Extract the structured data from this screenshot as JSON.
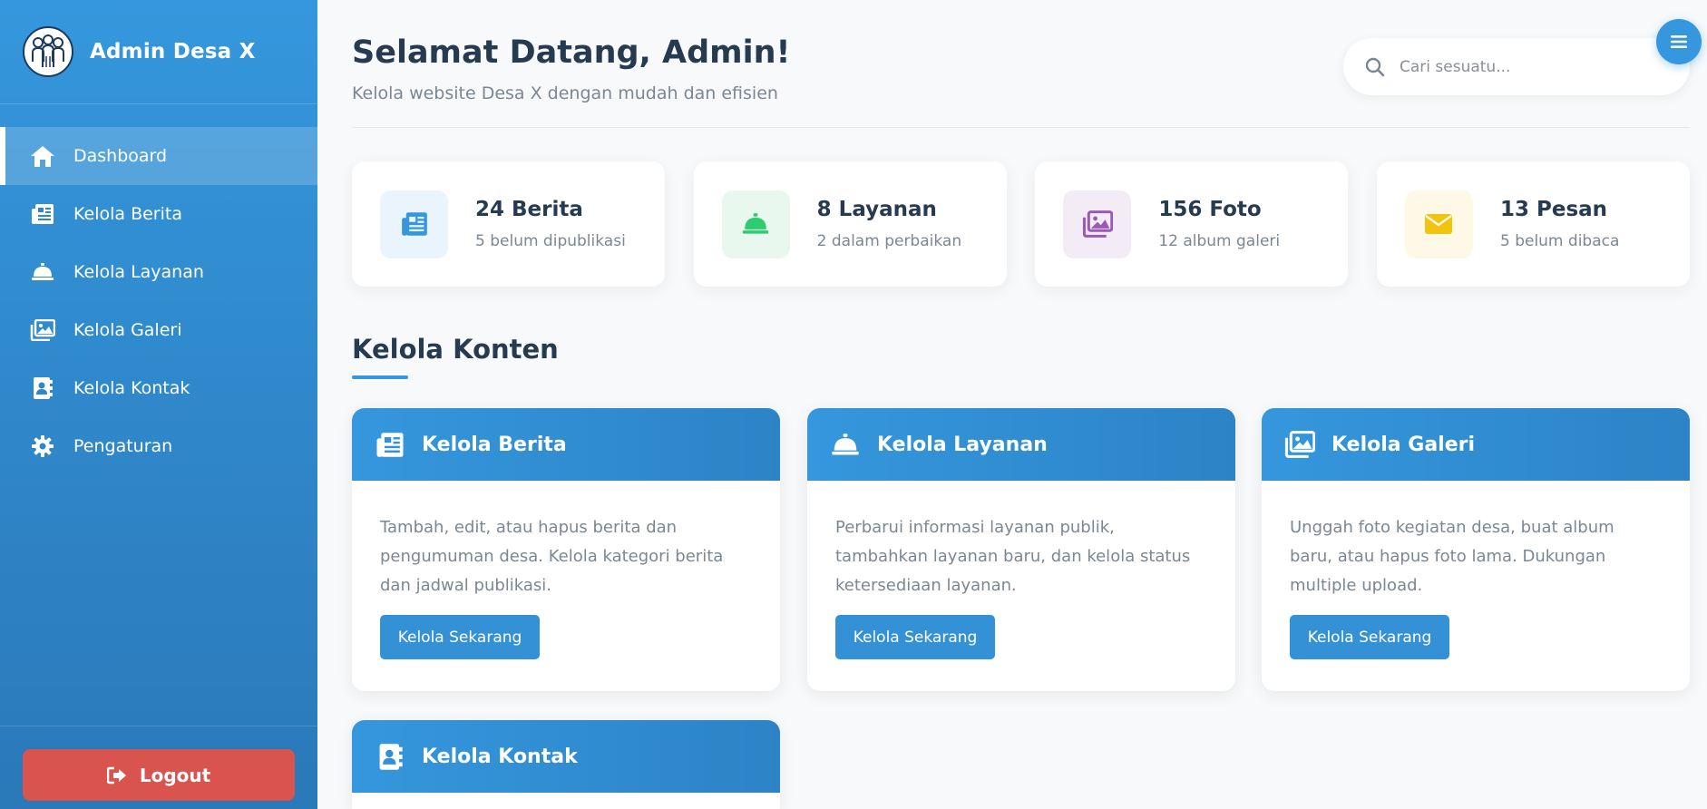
{
  "sidebar": {
    "brand_title": "Admin Desa X",
    "items": [
      {
        "label": "Dashboard",
        "icon": "home-icon",
        "active": true
      },
      {
        "label": "Kelola Berita",
        "icon": "newspaper-icon",
        "active": false
      },
      {
        "label": "Kelola Layanan",
        "icon": "concierge-bell-icon",
        "active": false
      },
      {
        "label": "Kelola Galeri",
        "icon": "images-icon",
        "active": false
      },
      {
        "label": "Kelola Kontak",
        "icon": "address-book-icon",
        "active": false
      },
      {
        "label": "Pengaturan",
        "icon": "gear-icon",
        "active": false
      }
    ],
    "logout_label": "Logout"
  },
  "header": {
    "title": "Selamat Datang, Admin!",
    "subtitle": "Kelola website Desa X dengan mudah dan efisien",
    "search_placeholder": "Cari sesuatu..."
  },
  "stats": [
    {
      "value": "24 Berita",
      "sub": "5 belum dipublikasi",
      "icon": "newspaper-icon",
      "color": "#3597dd",
      "bg": "#eaf4fc"
    },
    {
      "value": "8 Layanan",
      "sub": "2 dalam perbaikan",
      "icon": "concierge-bell-icon",
      "color": "#2ecc71",
      "bg": "#e9f8ef"
    },
    {
      "value": "156 Foto",
      "sub": "12 album galeri",
      "icon": "images-icon",
      "color": "#9b59b6",
      "bg": "#f3ecf7"
    },
    {
      "value": "13 Pesan",
      "sub": "5 belum dibaca",
      "icon": "envelope-icon",
      "color": "#f1c40f",
      "bg": "#fef8e6"
    }
  ],
  "section": {
    "title": "Kelola Konten"
  },
  "cards": [
    {
      "title": "Kelola Berita",
      "icon": "newspaper-icon",
      "desc": "Tambah, edit, atau hapus berita dan pengumuman desa. Kelola kategori berita dan jadwal publikasi.",
      "button": "Kelola Sekarang"
    },
    {
      "title": "Kelola Layanan",
      "icon": "concierge-bell-icon",
      "desc": "Perbarui informasi layanan publik, tambahkan layanan baru, dan kelola status ketersediaan layanan.",
      "button": "Kelola Sekarang"
    },
    {
      "title": "Kelola Galeri",
      "icon": "images-icon",
      "desc": "Unggah foto kegiatan desa, buat album baru, atau hapus foto lama. Dukungan multiple upload.",
      "button": "Kelola Sekarang"
    },
    {
      "title": "Kelola Kontak",
      "icon": "address-book-icon",
      "desc": "",
      "button": ""
    }
  ],
  "colors": {
    "primary": "#3597dd",
    "danger": "#d9534f",
    "heading": "#263a50",
    "muted": "#7a8794"
  }
}
